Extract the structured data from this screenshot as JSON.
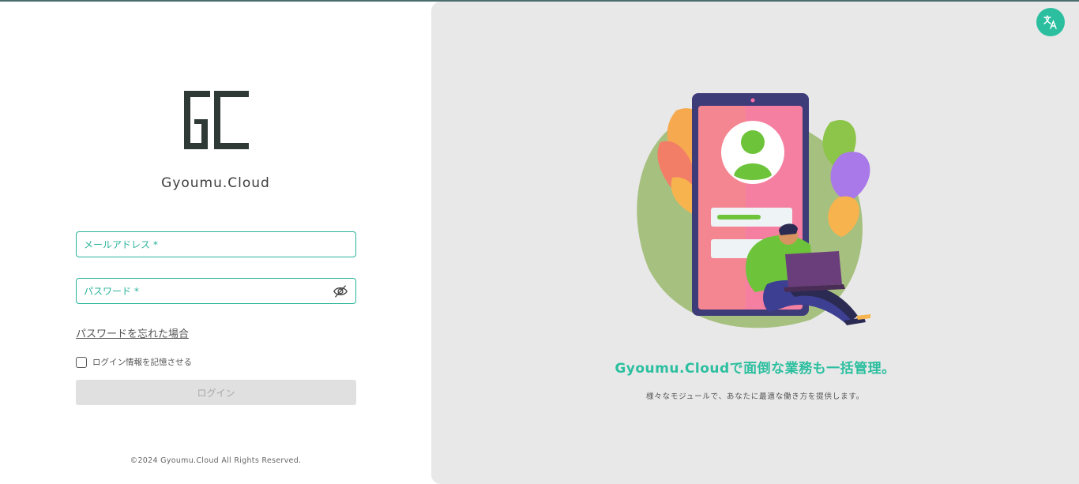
{
  "brand": {
    "name": "Gyoumu.Cloud",
    "logo_icon": "gc-logo-icon"
  },
  "form": {
    "email_placeholder": "メールアドレス *",
    "password_placeholder": "パスワード *",
    "password_toggle_icon": "eye-off-icon",
    "forgot_password": "パスワードを忘れた場合",
    "remember_label": "ログイン情報を記憶させる",
    "remember_checked": false,
    "login_button": "ログイン"
  },
  "footer": {
    "copyright": "©2024 Gyoumu.Cloud All Rights Reserved."
  },
  "hero": {
    "headline": "Gyoumu.Cloudで面倒な業務も一括管理。",
    "subline": "様々なモジュールで、あなたに最適な働き方を提供します。"
  },
  "language_button_icon": "translate-icon",
  "colors": {
    "accent": "#2bbf9f",
    "field_border": "#2bb39a",
    "logo": "#2f3a37",
    "right_bg": "#e8e8e8",
    "button_disabled": "#e0e0e0"
  }
}
